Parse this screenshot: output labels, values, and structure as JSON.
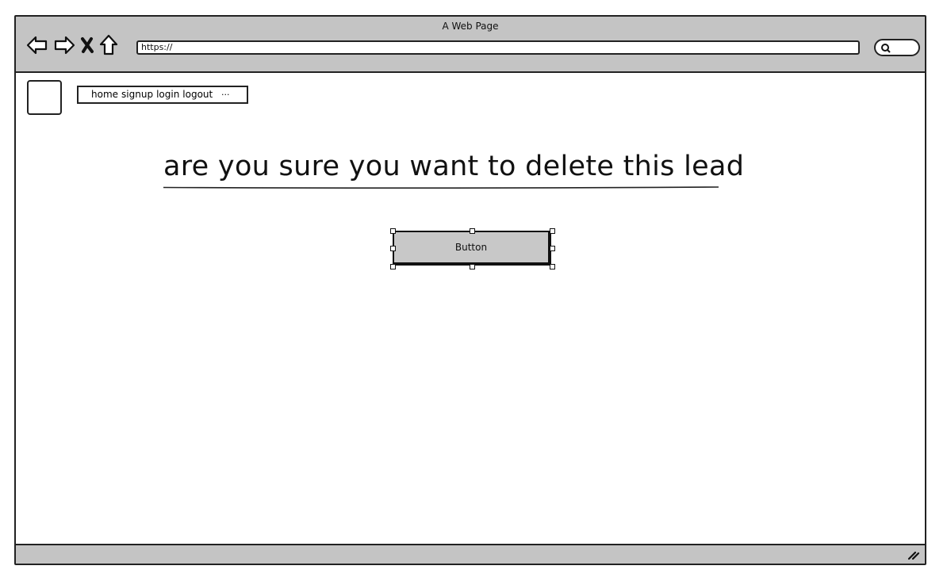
{
  "window": {
    "title": "A Web Page",
    "url": "https://"
  },
  "nav": {
    "links": [
      "home",
      "signup",
      "login",
      "logout"
    ],
    "more": "..."
  },
  "main": {
    "heading": "are you sure you want to delete this lead",
    "button_label": "Button"
  },
  "colors": {
    "chrome": "#c4c4c4",
    "button": "#c8c8c8",
    "stroke": "#222222"
  },
  "icons": [
    "back-arrow-icon",
    "forward-arrow-icon",
    "close-icon",
    "home-icon",
    "search-icon",
    "resize-grip-icon"
  ]
}
